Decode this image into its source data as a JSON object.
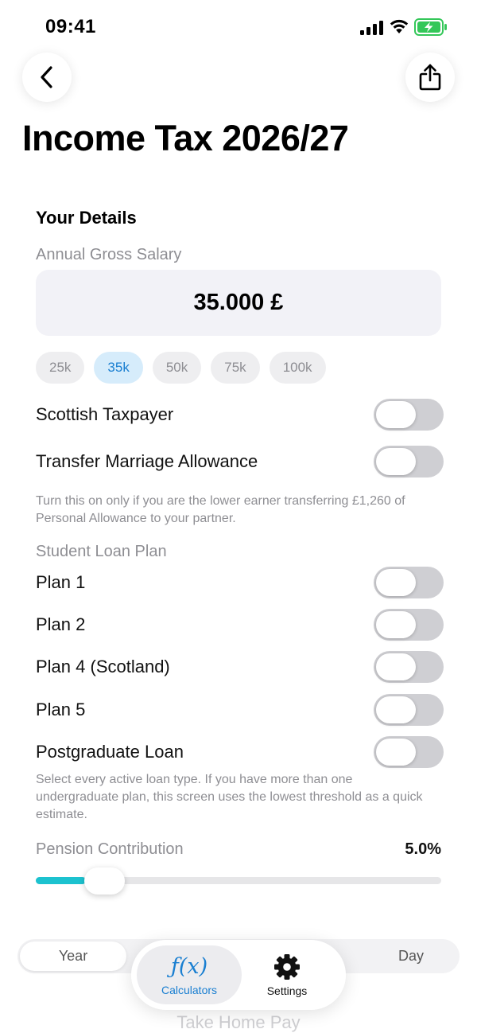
{
  "status": {
    "time": "09:41"
  },
  "header": {
    "title": "Income Tax 2026/27"
  },
  "details": {
    "heading": "Your Details",
    "salary_label": "Annual Gross Salary",
    "salary_value": "35.000 £",
    "presets": [
      "25k",
      "35k",
      "50k",
      "75k",
      "100k"
    ],
    "selected_preset": "35k"
  },
  "options": {
    "scottish_label": "Scottish Taxpayer",
    "scottish_on": false,
    "marriage_label": "Transfer Marriage Allowance",
    "marriage_on": false,
    "marriage_help": "Turn this on only if you are the lower earner transferring £1,260 of Personal Allowance to your partner."
  },
  "student_loan": {
    "heading": "Student Loan Plan",
    "plans": [
      {
        "label": "Plan 1",
        "on": false
      },
      {
        "label": "Plan 2",
        "on": false
      },
      {
        "label": "Plan 4 (Scotland)",
        "on": false
      },
      {
        "label": "Plan 5",
        "on": false
      },
      {
        "label": "Postgraduate Loan",
        "on": false
      }
    ],
    "help": "Select every active loan type. If you have more than one undergraduate plan, this screen uses the lowest threshold as a quick estimate."
  },
  "pension": {
    "label": "Pension Contribution",
    "value_text": "5.0%",
    "level_fraction": 0.1
  },
  "period_selector": {
    "year": "Year",
    "day": "Day",
    "selected": "Year"
  },
  "faded_section_title": "Take Home Pay",
  "tabs": {
    "calculators": "Calculators",
    "settings": "Settings",
    "active": "Calculators"
  },
  "colors": {
    "accent": "#1a7fd1",
    "slider": "#1cc2cf",
    "toggle_off": "#cfcfd3",
    "chip_selected_bg": "#d6ecfb"
  }
}
